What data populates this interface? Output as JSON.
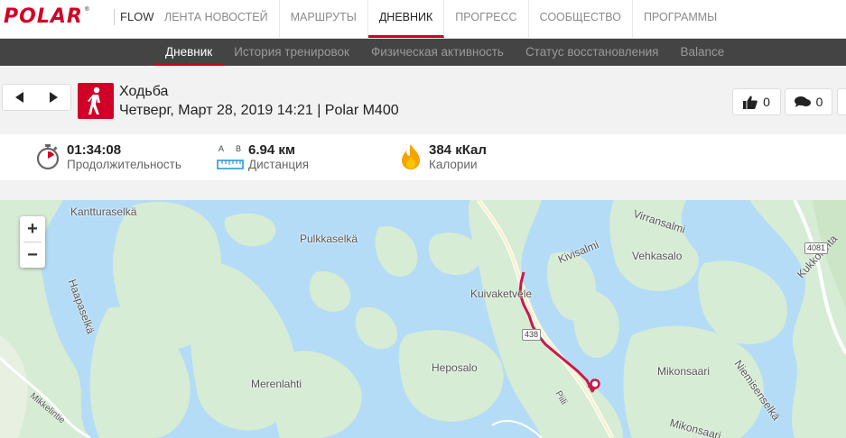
{
  "brand": {
    "logo_text": "POLAR",
    "reg_mark": "®",
    "product": "FLOW",
    "color": "#d10027"
  },
  "topnav": {
    "items": [
      "ЛЕНТА НОВОСТЕЙ",
      "МАРШРУТЫ",
      "ДНЕВНИК",
      "ПРОГРЕСС",
      "СООБЩЕСТВО",
      "ПРОГРАММЫ"
    ],
    "active": "ДНЕВНИК"
  },
  "subnav": {
    "items": [
      "Дневник",
      "История тренировок",
      "Физическая активность",
      "Статус восстановления",
      "Balance"
    ],
    "active": "Дневник"
  },
  "session": {
    "sport": "Ходьба",
    "datetime": "Четверг, Март 28, 2019 14:21 | Polar M400",
    "likes": "0",
    "comments": "0"
  },
  "summary": {
    "duration_value": "01:34:08",
    "duration_label": "Продолжительность",
    "distance_value": "6.94 км",
    "distance_label": "Дистанция",
    "distance_icon_a": "A",
    "distance_icon_b": "B",
    "calories_value": "384 кКал",
    "calories_label": "Калории"
  },
  "map": {
    "zoom_in": "+",
    "zoom_out": "−",
    "labels": [
      "Kantturaselkä",
      "Pulkkaselkä",
      "Haapaselkä",
      "Kuivaketvele",
      "Kivisalmi",
      "Virransalmi",
      "Vehkasalo",
      "Kukkoluhta",
      "Heposalo",
      "Merenlahti",
      "Mikonsaari",
      "Niemisenselkä",
      "Mikonsaari",
      "Mikkelintie",
      "Piili"
    ],
    "road_numbers": [
      "4081",
      "438"
    ],
    "route_color": "#c8194b"
  }
}
